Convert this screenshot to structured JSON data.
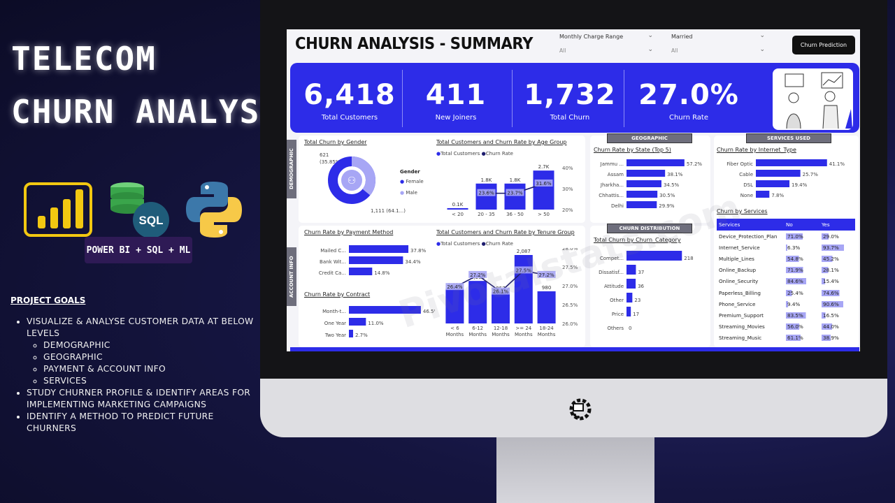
{
  "hero": {
    "title_line1": "TELECOM",
    "title_line2": "CHURN  ANALYSIS",
    "stack_label": "POWER BI + SQL + ML",
    "sql_logo_text": "SQL"
  },
  "goals": {
    "heading": "PROJECT GOALS",
    "items": [
      "VISUALIZE & ANALYSE CUSTOMER DATA AT BELOW LEVELS",
      "STUDY CHURNER PROFILE & IDENTIFY AREAS FOR IMPLEMENTING MARKETING CAMPAIGNS",
      "IDENTIFY A METHOD TO PREDICT FUTURE CHURNERS"
    ],
    "sub_items": [
      "DEMOGRAPHIC",
      "GEOGRAPHIC",
      "PAYMENT & ACCOUNT INFO",
      "SERVICES"
    ]
  },
  "dashboard": {
    "title": "CHURN ANALYSIS - SUMMARY",
    "slicers": [
      {
        "label": "Monthly Charge Range",
        "value": "All"
      },
      {
        "label": "Married",
        "value": "All"
      }
    ],
    "predict_button": "Churn Prediction",
    "kpis": [
      {
        "value": "6,418",
        "label": "Total Customers"
      },
      {
        "value": "411",
        "label": "New Joiners"
      },
      {
        "value": "1,732",
        "label": "Total Churn"
      },
      {
        "value": "27.0%",
        "label": "Churn Rate"
      }
    ],
    "section_tags": {
      "demographic": "DEMOGRAPHIC",
      "account": "ACCOUNT INFO",
      "geographic": "GEOGRAPHIC",
      "services": "SERVICES USED",
      "churn_distribution": "CHURN DISTRIBUTION"
    },
    "watermark": "Pivotalstats.com",
    "colors": {
      "primary": "#2d2ce8",
      "light": "#a7a6f5",
      "line": "#1d1c6e"
    }
  },
  "chart_data": [
    {
      "type": "pie",
      "title": "Total Churn by Gender",
      "legend_title": "Gender",
      "categories": [
        "Female",
        "Male"
      ],
      "values": [
        621,
        1111
      ],
      "data_labels": [
        "621\n(35.85%)",
        "1,111 (64.1...)"
      ]
    },
    {
      "type": "bar",
      "title": "Total Customers and Churn Rate by Age Group",
      "legend": [
        "Total Customers",
        "Churn Rate"
      ],
      "categories": [
        "< 20",
        "20 - 35",
        "36 - 50",
        "> 50"
      ],
      "series": [
        {
          "name": "Total Customers",
          "values": [
            0.1,
            1.8,
            1.8,
            2.7
          ],
          "labels": [
            "0.1K",
            "1.8K",
            "1.8K",
            "2.7K"
          ]
        },
        {
          "name": "Churn Rate",
          "values": [
            null,
            23.6,
            23.7,
            31.6
          ],
          "labels": [
            "",
            "23.6%",
            "23.7%",
            "31.6%"
          ]
        }
      ],
      "y2_ticks": [
        "40%",
        "30%",
        "20%"
      ]
    },
    {
      "type": "bar",
      "title": "Churn Rate by Payment Method",
      "categories": [
        "Mailed C...",
        "Bank Wit...",
        "Credit Ca..."
      ],
      "values": [
        37.8,
        34.4,
        14.8
      ],
      "labels": [
        "37.8%",
        "34.4%",
        "14.8%"
      ]
    },
    {
      "type": "bar",
      "title": "Churn Rate by Contract",
      "categories": [
        "Month-t...",
        "One Year",
        "Two Year"
      ],
      "values": [
        46.5,
        11.0,
        2.7
      ],
      "labels": [
        "46.5%",
        "11.0%",
        "2.7%"
      ]
    },
    {
      "type": "bar",
      "title": "Total Customers and Churn Rate by Tenure Group",
      "legend": [
        "Total Customers",
        "Churn Rate"
      ],
      "categories": [
        "< 6 Months",
        "6-12 Months",
        "12-18 Months",
        ">= 24 Months",
        "18-24 Months"
      ],
      "series": [
        {
          "name": "Total Customers",
          "values": [
            1058,
            1296,
            957,
            2087,
            980
          ],
          "labels": [
            "1,058",
            "1,296",
            "957",
            "2,087",
            "980"
          ]
        },
        {
          "name": "Churn Rate",
          "values": [
            26.4,
            27.2,
            26.1,
            27.5,
            27.2
          ],
          "labels": [
            "26.4%",
            "27.2%",
            "26.1%",
            "27.5%",
            "27.2%"
          ]
        }
      ],
      "y2_ticks": [
        "28.0%",
        "27.5%",
        "27.0%",
        "26.5%",
        "26.0%"
      ]
    },
    {
      "type": "bar",
      "title": "Churn Rate by State (Top 5)",
      "categories": [
        "Jammu ...",
        "Assam",
        "Jharkha...",
        "Chhattis...",
        "Delhi"
      ],
      "values": [
        57.2,
        38.1,
        34.5,
        30.5,
        29.9
      ],
      "labels": [
        "57.2%",
        "38.1%",
        "34.5%",
        "30.5%",
        "29.9%"
      ]
    },
    {
      "type": "bar",
      "title": "Total Churn by Churn_Category",
      "categories": [
        "Compet...",
        "Dissatisf...",
        "Attitude",
        "Other",
        "Price",
        "Others"
      ],
      "values": [
        218,
        37,
        36,
        23,
        17,
        0
      ],
      "labels": [
        "218",
        "37",
        "36",
        "23",
        "17",
        "0"
      ]
    },
    {
      "type": "bar",
      "title": "Churn Rate by Internet_Type",
      "categories": [
        "Fiber Optic",
        "Cable",
        "DSL",
        "None"
      ],
      "values": [
        41.1,
        25.7,
        19.4,
        7.8
      ],
      "labels": [
        "41.1%",
        "25.7%",
        "19.4%",
        "7.8%"
      ]
    },
    {
      "type": "table",
      "title": "Churn by Services",
      "columns": [
        "Services",
        "No",
        "Yes"
      ],
      "rows": [
        [
          "Device_Protection_Plan",
          "71.0%",
          "29.0%"
        ],
        [
          "Internet_Service",
          "6.3%",
          "93.7%"
        ],
        [
          "Multiple_Lines",
          "54.8%",
          "45.2%"
        ],
        [
          "Online_Backup",
          "71.9%",
          "28.1%"
        ],
        [
          "Online_Security",
          "84.6%",
          "15.4%"
        ],
        [
          "Paperless_Billing",
          "25.4%",
          "74.6%"
        ],
        [
          "Phone_Service",
          "9.4%",
          "90.6%"
        ],
        [
          "Premium_Support",
          "83.5%",
          "16.5%"
        ],
        [
          "Streaming_Movies",
          "56.0%",
          "44.0%"
        ],
        [
          "Streaming_Music",
          "61.1%",
          "38.9%"
        ]
      ]
    }
  ]
}
